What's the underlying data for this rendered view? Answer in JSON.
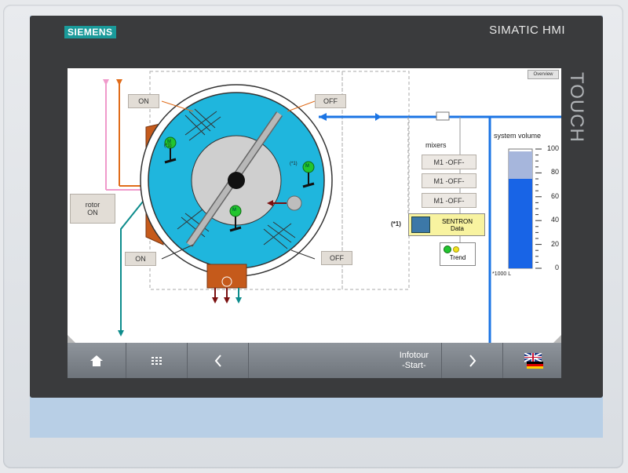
{
  "device": {
    "brand": "SIEMENS",
    "product": "SIMATIC HMI",
    "side_label": "TOUCH"
  },
  "screen": {
    "overview_label": "Overview",
    "buttons": {
      "on_top": "ON",
      "off_top": "OFF",
      "on_bottom": "ON",
      "off_bottom": "OFF",
      "rotor": "rotor\nON",
      "sentron": "SENTRON\nData",
      "trend": "Trend"
    },
    "mixers": {
      "title": "mixers",
      "items": [
        "M1 -OFF-",
        "M1 -OFF-",
        "M1 -OFF-"
      ]
    },
    "notes": {
      "footnote_marker": "(*1)",
      "motor_marker_a": "(*1)",
      "motor_marker_b": "(*1)",
      "motor_letter": "M"
    },
    "system_volume": {
      "title": "system volume",
      "ticks": [
        "100",
        "80",
        "60",
        "40",
        "20",
        "0"
      ],
      "unit_note": "*1000 L",
      "level_fraction": 0.75,
      "upper_fraction": 0.23
    }
  },
  "navbar": {
    "home_icon": "home-icon",
    "grid_icon": "grid-icon",
    "back_icon": "chevron-left-icon",
    "infotour": "Infotour\n-Start-",
    "next_icon": "chevron-right-icon",
    "language_icon": "language-flags-icon"
  },
  "colors": {
    "drum": "#1fb6dd",
    "pipe_blue": "#1b74e4",
    "orange": "#e06c1a",
    "pink": "#f09acb",
    "teal": "#0d8c8c",
    "brown": "#c55a1b"
  }
}
